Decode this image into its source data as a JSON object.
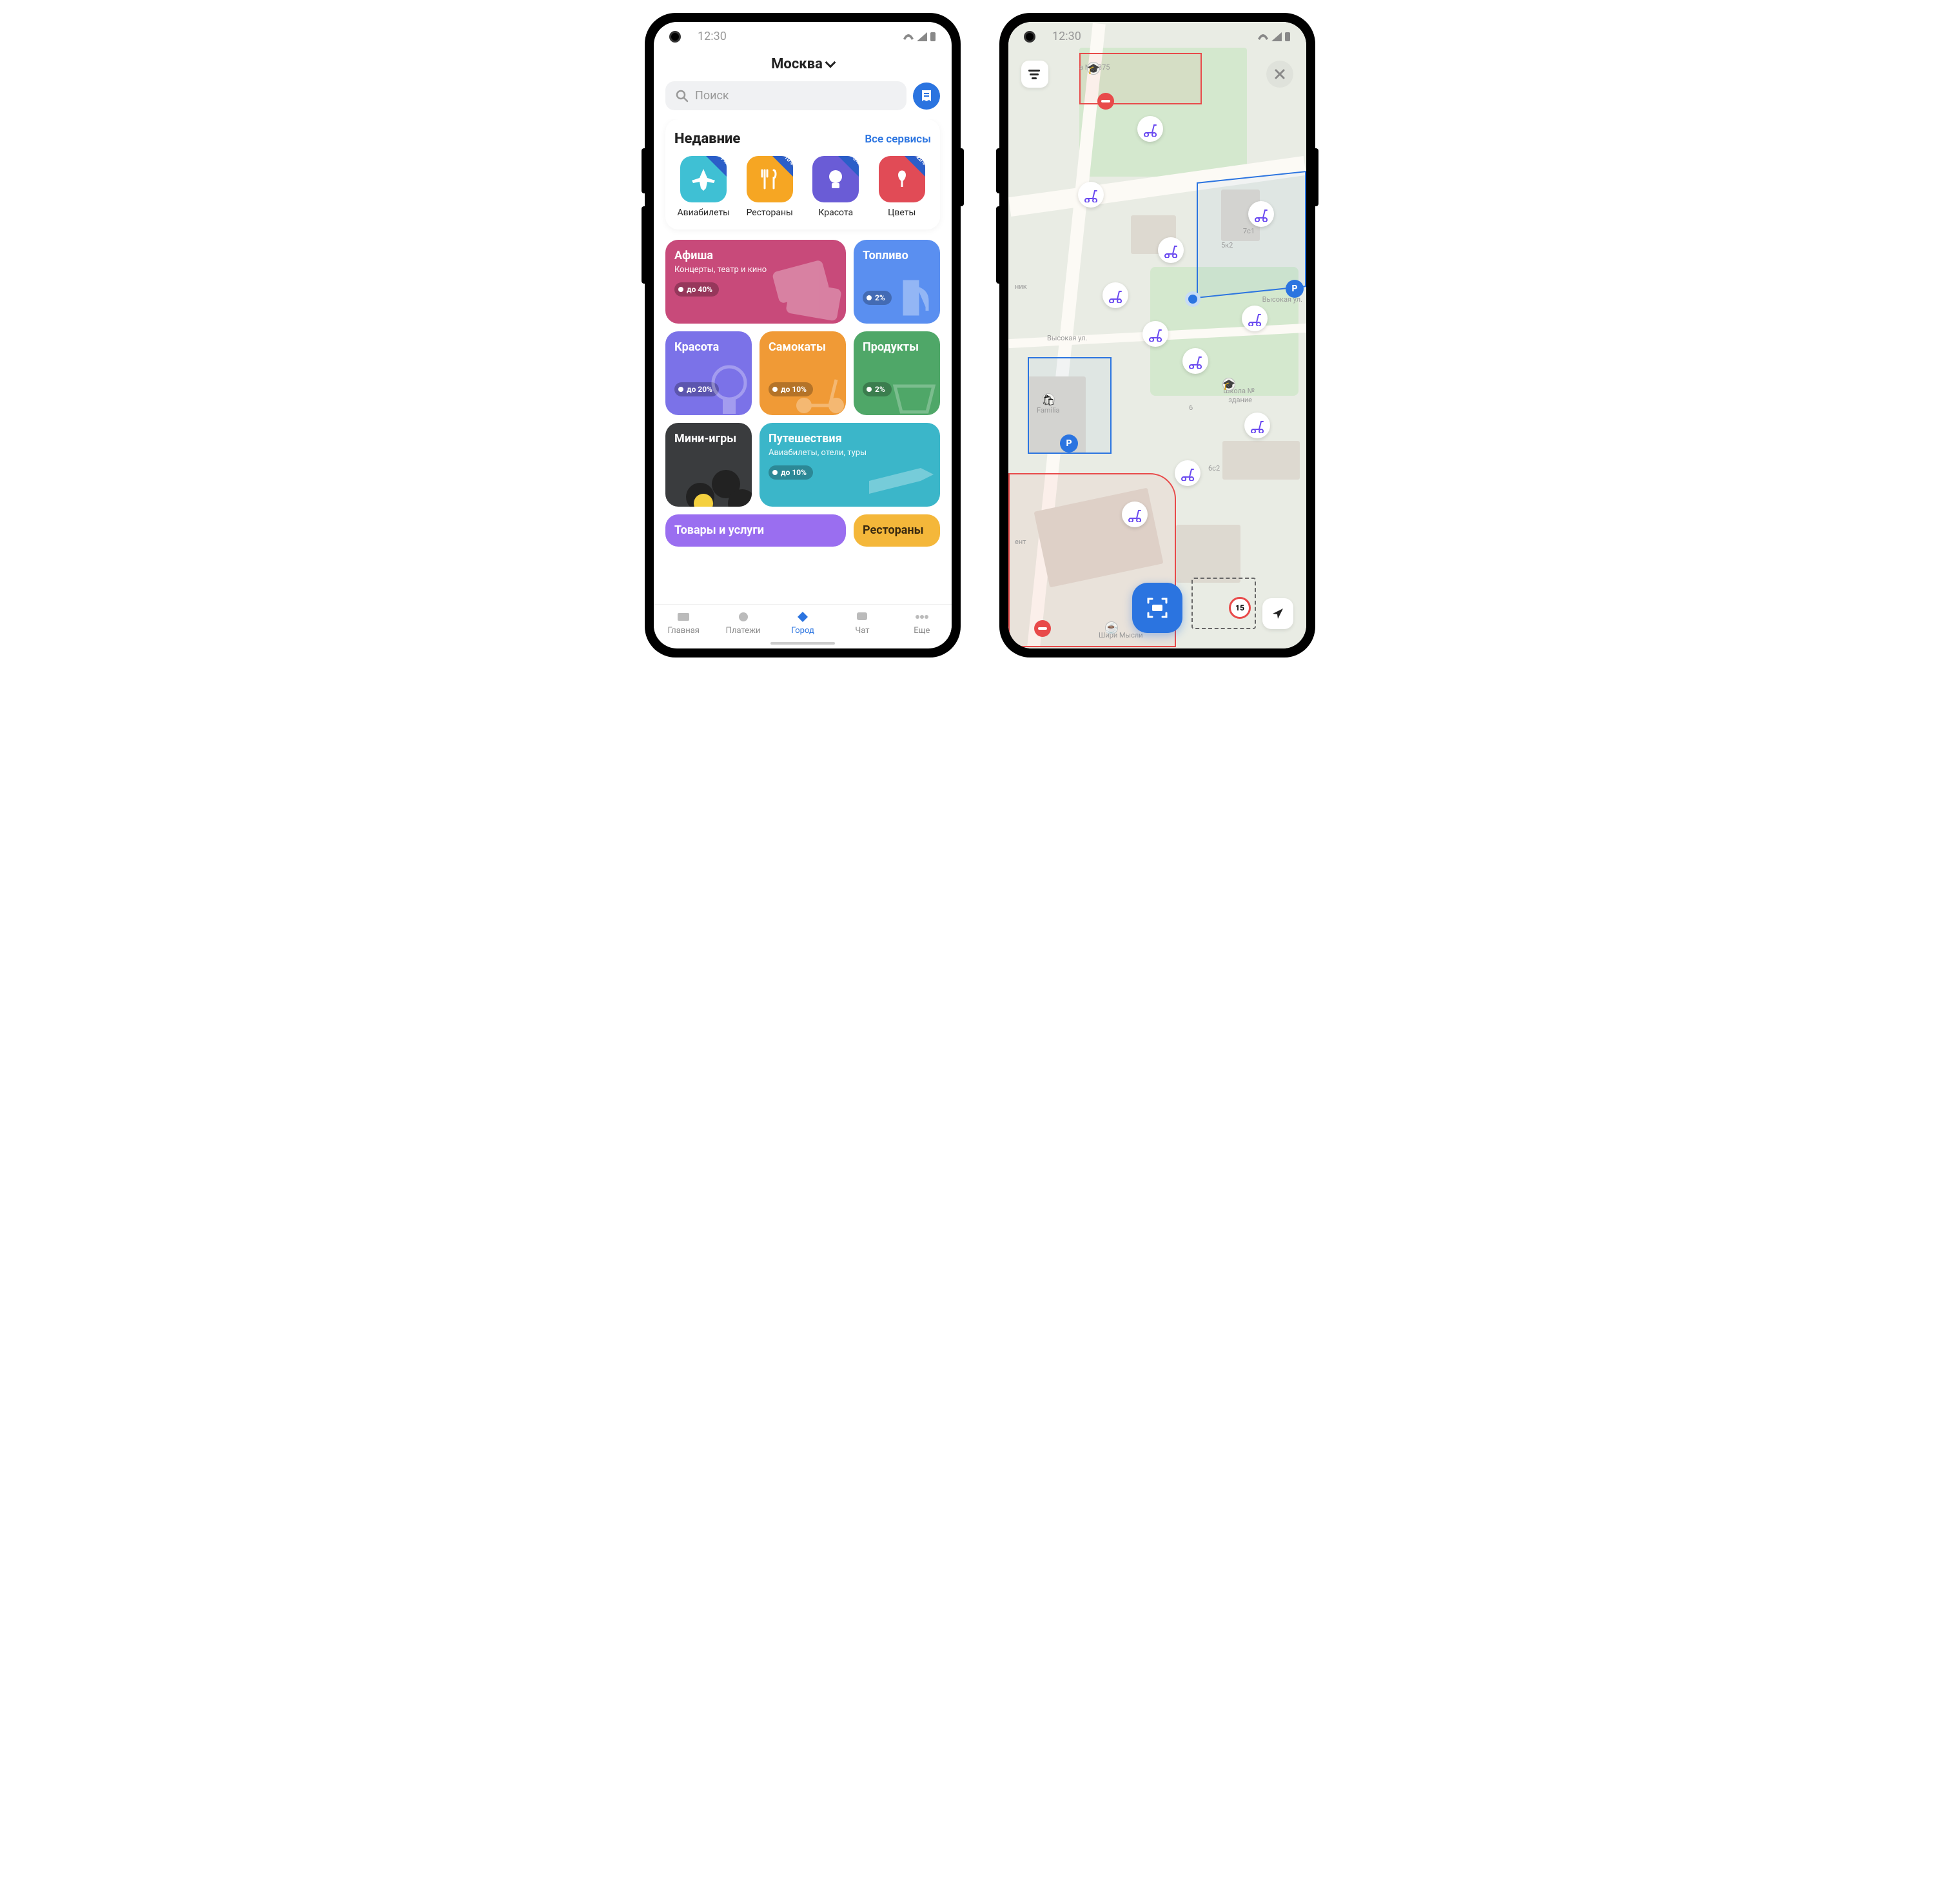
{
  "status": {
    "time": "12:30"
  },
  "city_screen": {
    "header": {
      "city": "Москва"
    },
    "search": {
      "placeholder": "Поиск"
    },
    "recent": {
      "title": "Недавние",
      "all_link": "Все сервисы",
      "items": [
        {
          "label": "Авиабилеты",
          "cashback": "7%",
          "color": "#3fc0d4"
        },
        {
          "label": "Рестораны",
          "cashback": "10%",
          "color": "#f6a623"
        },
        {
          "label": "Красота",
          "cashback": "5%",
          "color": "#6a5cd6"
        },
        {
          "label": "Цветы",
          "cashback": "20%",
          "color": "#e14b56"
        }
      ]
    },
    "tiles": [
      {
        "title": "Афиша",
        "sub": "Концерты, театр и кино",
        "pill": "до 40%",
        "color": "#c84a7a",
        "span": 2
      },
      {
        "title": "Топливо",
        "sub": "",
        "pill": "2%",
        "color": "#5a8ff0",
        "span": 1
      },
      {
        "title": "Красота",
        "sub": "",
        "pill": "до 20%",
        "color": "#7b72e8",
        "span": 1
      },
      {
        "title": "Самокаты",
        "sub": "",
        "pill": "до 10%",
        "color": "#f09a36",
        "span": 1
      },
      {
        "title": "Продукты",
        "sub": "",
        "pill": "2%",
        "color": "#4fa768",
        "span": 1
      },
      {
        "title": "Мини-игры",
        "sub": "",
        "pill": "",
        "color": "#3a3c3e",
        "span": 1
      },
      {
        "title": "Путешествия",
        "sub": "Авиабилеты, отели, туры",
        "pill": "до 10%",
        "color": "#3bb6c9",
        "span": 2
      },
      {
        "title": "Товары и услуги",
        "sub": "",
        "pill": "",
        "color": "#9a6ef0",
        "span": 2
      },
      {
        "title": "Рестораны",
        "sub": "",
        "pill": "",
        "color": "#f4b73a",
        "span": 1
      }
    ],
    "tabs": [
      {
        "label": "Главная"
      },
      {
        "label": "Платежи"
      },
      {
        "label": "Город"
      },
      {
        "label": "Чат"
      },
      {
        "label": "Еще"
      }
    ],
    "active_tab": 2
  },
  "map_screen": {
    "speed_limit": "15",
    "streets": {
      "s1": "Высокая ул.",
      "s2": "Высокая ул."
    },
    "building_labels": {
      "b1": "5к2",
      "b2": "7с1",
      "b3": "6",
      "b4": "6с2"
    },
    "pois": {
      "school": "Школа №",
      "school2": "здание",
      "familia": "Familia",
      "sh1375": "а № 1375",
      "mysli": "Шири Мысли",
      "ent": "ент",
      "nik": "ник"
    },
    "parking": "P"
  }
}
